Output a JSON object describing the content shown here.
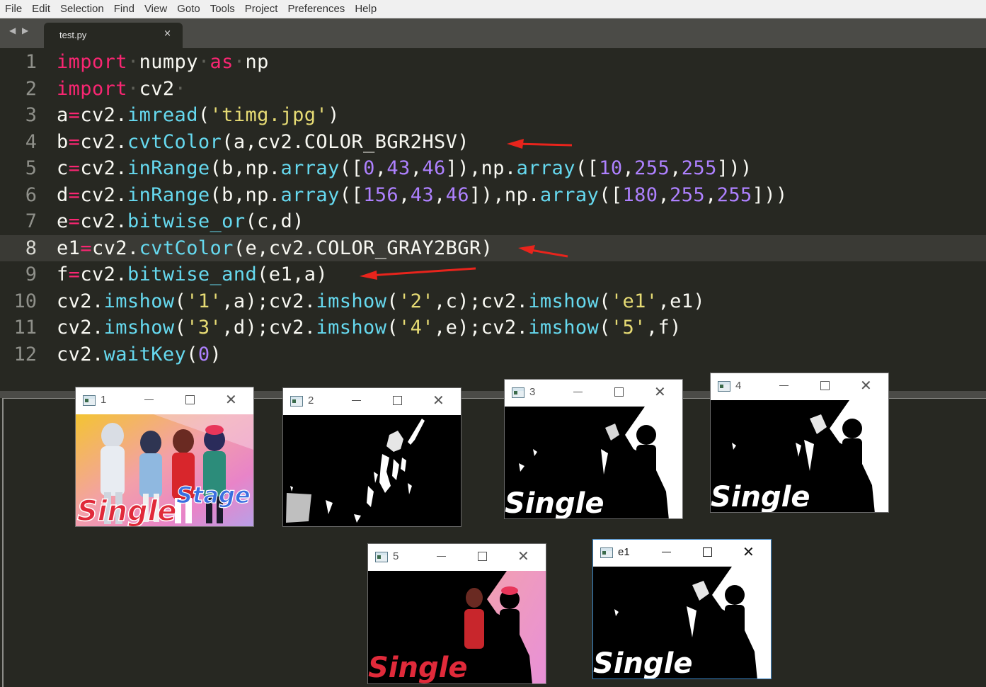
{
  "menu": {
    "items": [
      "File",
      "Edit",
      "Selection",
      "Find",
      "View",
      "Goto",
      "Tools",
      "Project",
      "Preferences",
      "Help"
    ]
  },
  "tabs": {
    "nav_back_icon": "◀",
    "nav_forward_icon": "▶",
    "active": {
      "title": "test.py",
      "close_icon": "×"
    }
  },
  "editor": {
    "current_line": 8,
    "lines": [
      {
        "n": "1",
        "text": "import·numpy·as·np"
      },
      {
        "n": "2",
        "text": "import·cv2·"
      },
      {
        "n": "3",
        "text": "a=cv2.imread('timg.jpg')"
      },
      {
        "n": "4",
        "text": "b=cv2.cvtColor(a,cv2.COLOR_BGR2HSV)"
      },
      {
        "n": "5",
        "text": "c=cv2.inRange(b,np.array([0,43,46]),np.array([10,255,255]))"
      },
      {
        "n": "6",
        "text": "d=cv2.inRange(b,np.array([156,43,46]),np.array([180,255,255]))"
      },
      {
        "n": "7",
        "text": "e=cv2.bitwise_or(c,d)"
      },
      {
        "n": "8",
        "text": "e1=cv2.cvtColor(e,cv2.COLOR_GRAY2BGR)"
      },
      {
        "n": "9",
        "text": "f=cv2.bitwise_and(e1,a)"
      },
      {
        "n": "10",
        "text": "cv2.imshow('1',a);cv2.imshow('2',c);cv2.imshow('e1',e1)"
      },
      {
        "n": "11",
        "text": "cv2.imshow('3',d);cv2.imshow('4',e);cv2.imshow('5',f)"
      },
      {
        "n": "12",
        "text": "cv2.waitKey(0)"
      }
    ],
    "annotation_color": "#e8241c"
  },
  "windows": [
    {
      "id": "win-1",
      "title": "1",
      "image_text": "Single",
      "image_text_2": "Stage"
    },
    {
      "id": "win-2",
      "title": "2"
    },
    {
      "id": "win-3",
      "title": "3",
      "image_text": "Single"
    },
    {
      "id": "win-4",
      "title": "4",
      "image_text": "Single"
    },
    {
      "id": "win-5",
      "title": "5",
      "image_text": "Single"
    },
    {
      "id": "win-e1",
      "title": "e1",
      "image_text": "Single"
    }
  ],
  "window_controls": {
    "minimize_icon": "—",
    "maximize_icon": "☐",
    "close_icon": "✕"
  },
  "colors": {
    "editor_bg": "#272822",
    "keyword": "#f92672",
    "function": "#66d9ef",
    "string": "#e6db74",
    "number": "#ae81ff",
    "text": "#f8f8f2"
  }
}
